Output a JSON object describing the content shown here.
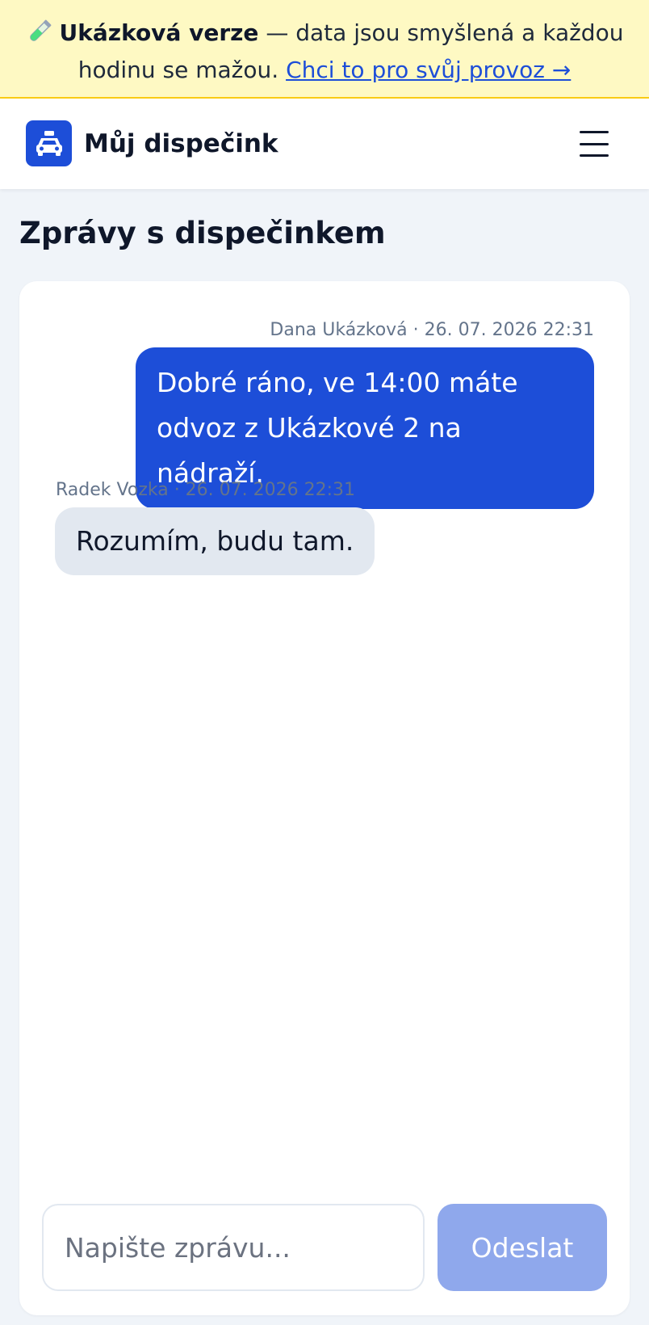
{
  "banner": {
    "icon": "test-tube-icon",
    "title": "Ukázková verze",
    "text": " — data jsou smyšlená a každou hodinu se mažou. ",
    "link": "Chci to pro svůj provoz →"
  },
  "header": {
    "logo_icon": "taxi-icon",
    "brand": "Můj dispečink",
    "menu_icon": "hamburger-menu-icon"
  },
  "page": {
    "title": "Zprávy s dispečinkem"
  },
  "messages": [
    {
      "direction": "outgoing",
      "meta": "Dana Ukázková · 26. 07. 2026 22:31",
      "text": "Dobré ráno, ve 14:00 máte odvoz z Ukázkové 2 na nádraží."
    },
    {
      "direction": "incoming",
      "meta": "Radek Vozka · 26. 07. 2026 22:31",
      "text": "Rozumím, budu tam."
    }
  ],
  "composer": {
    "value": "",
    "placeholder": "Napište zprávu...",
    "send_label": "Odeslat"
  },
  "colors": {
    "primary": "#1d4ed8",
    "send_disabled": "#8fa8ec",
    "banner_bg": "#fef9c3",
    "banner_border": "#facc15",
    "page_bg": "#f0f4f9",
    "incoming_bubble": "#e2e8f0",
    "muted_text": "#64748b"
  }
}
